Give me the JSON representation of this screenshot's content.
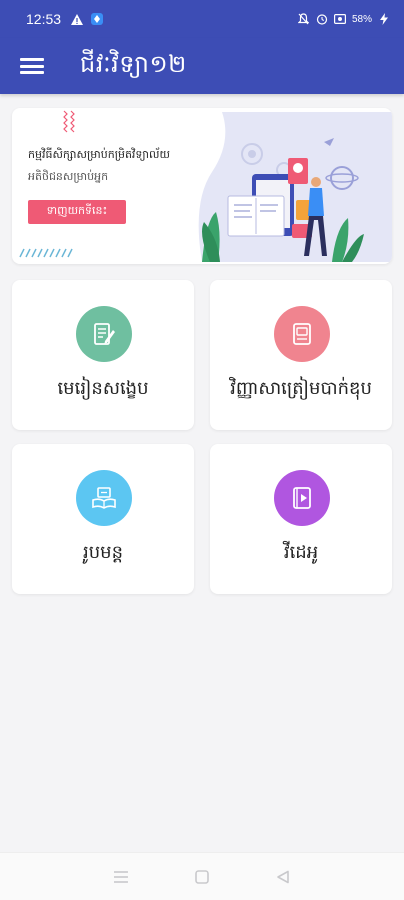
{
  "status_bar": {
    "time": "12:53",
    "battery": "58%"
  },
  "app_bar": {
    "title": "ជីវៈវិទ្យា១២"
  },
  "banner": {
    "headline": "កម្មវិធីសិក្សាសម្រាប់កម្រិតវិទ្យាល័យ",
    "subtitle": "អតិថិជនសម្រាប់អ្នក",
    "button_label": "ទាញយកទីនេះ"
  },
  "cards": [
    {
      "label": "មេរៀនសង្ខេប",
      "icon": "notes-icon",
      "color": "#6fbfa0"
    },
    {
      "label": "វិញ្ញាសាត្រៀមបាក់ឌុប",
      "icon": "book-icon",
      "color": "#f0848f"
    },
    {
      "label": "រូបមន្ត",
      "icon": "formula-book-icon",
      "color": "#5cc6f2"
    },
    {
      "label": "វីដេអូ",
      "icon": "video-book-icon",
      "color": "#b056e0"
    }
  ],
  "colors": {
    "primary": "#3d4db5",
    "accent": "#ef5a75"
  }
}
